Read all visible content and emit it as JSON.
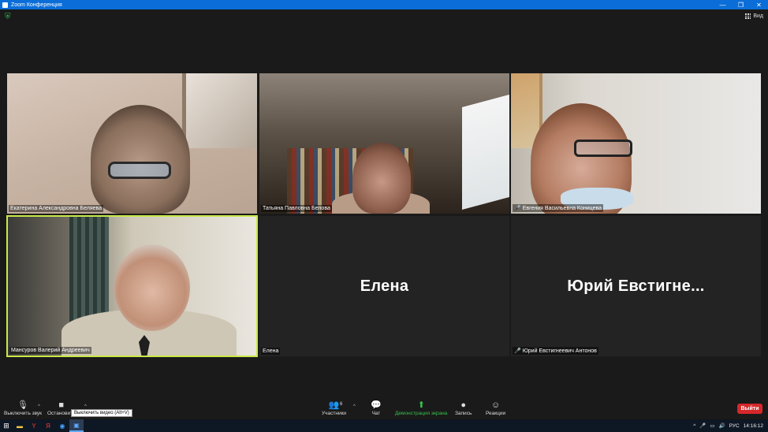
{
  "window": {
    "title": "Zoom Конференция",
    "controls": [
      "—",
      "❐",
      "✕"
    ]
  },
  "header": {
    "view_label": "Вид"
  },
  "participants": [
    {
      "name": "Екатерина Александровна Беляева",
      "muted": false,
      "video": true
    },
    {
      "name": "Татьяна Павловна Белова",
      "muted": false,
      "video": true
    },
    {
      "name": "Евгения Васильевна Коницева",
      "muted": true,
      "video": true
    },
    {
      "name": "Мансуров Валерий Андреевич",
      "muted": false,
      "video": true,
      "active_speaker": true
    },
    {
      "name": "Елена",
      "display": "Елена",
      "muted": false,
      "video": false
    },
    {
      "name": "Юрий Евстигнеевич Антонов",
      "display": "Юрий  Евстигне...",
      "muted": true,
      "video": false
    }
  ],
  "toolbar": {
    "mute_label": "Выключить звук",
    "video_label": "Остановить",
    "video_tooltip": "Выключить видео (Alt+V)",
    "participants_label": "Участники",
    "participants_count": "6",
    "chat_label": "Чат",
    "share_label": "Демонстрация экрана",
    "record_label": "Запись",
    "reactions_label": "Реакции",
    "leave_label": "Выйти"
  },
  "taskbar": {
    "lang": "РУС",
    "time": "14:16:12",
    "apps": [
      "file-explorer",
      "yandex-browser",
      "yandex",
      "chrome",
      "zoom"
    ]
  },
  "colors": {
    "accent": "#0b6ed8",
    "active_speaker": "#c9e84a",
    "leave": "#d6282b",
    "share": "#35c14d"
  }
}
